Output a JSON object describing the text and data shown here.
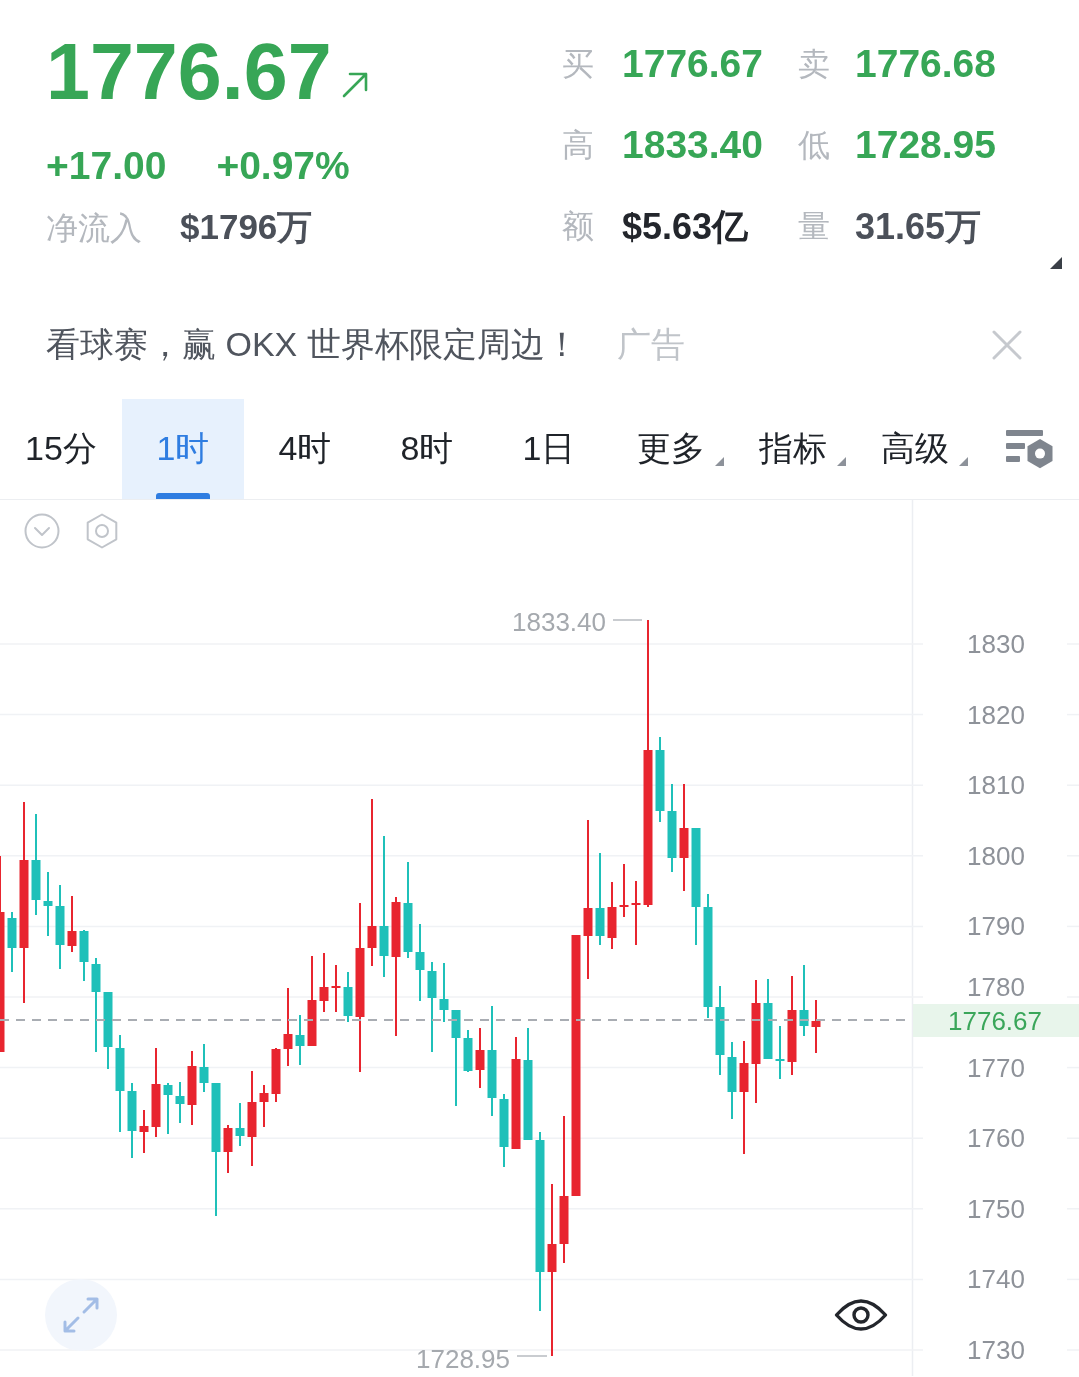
{
  "quote": {
    "last_price": "1776.67",
    "change": "+17.00",
    "change_percent": "+0.97%",
    "net_inflow_label": "净流入",
    "net_inflow_value": "$1796万"
  },
  "stats": [
    {
      "label": "买",
      "value": "1776.67",
      "kind": "price"
    },
    {
      "label": "卖",
      "value": "1776.68",
      "kind": "price"
    },
    {
      "label": "高",
      "value": "1833.40",
      "kind": "price"
    },
    {
      "label": "低",
      "value": "1728.95",
      "kind": "price"
    },
    {
      "label": "额",
      "value": "$5.63亿",
      "kind": "turnover"
    },
    {
      "label": "量",
      "value": "31.65万",
      "kind": "volume"
    }
  ],
  "ad": {
    "text": "看球赛，赢 OKX 世界杯限定周边！",
    "tag": "广告"
  },
  "timeframe_tabs": [
    {
      "label": "15分",
      "selected": false,
      "has_menu": false
    },
    {
      "label": "1时",
      "selected": true,
      "has_menu": false
    },
    {
      "label": "4时",
      "selected": false,
      "has_menu": false
    },
    {
      "label": "8时",
      "selected": false,
      "has_menu": false
    },
    {
      "label": "1日",
      "selected": false,
      "has_menu": false
    },
    {
      "label": "更多",
      "selected": false,
      "has_menu": true
    },
    {
      "label": "指标",
      "selected": false,
      "has_menu": true
    },
    {
      "label": "高级",
      "selected": false,
      "has_menu": true
    }
  ],
  "chart": {
    "y_axis_labels": [
      "1830",
      "1820",
      "1810",
      "1800",
      "1790",
      "1780",
      "1770",
      "1760",
      "1750",
      "1740",
      "1730"
    ],
    "high_label": "1833.40",
    "low_label": "1728.95",
    "current_price": "1776.67"
  }
}
